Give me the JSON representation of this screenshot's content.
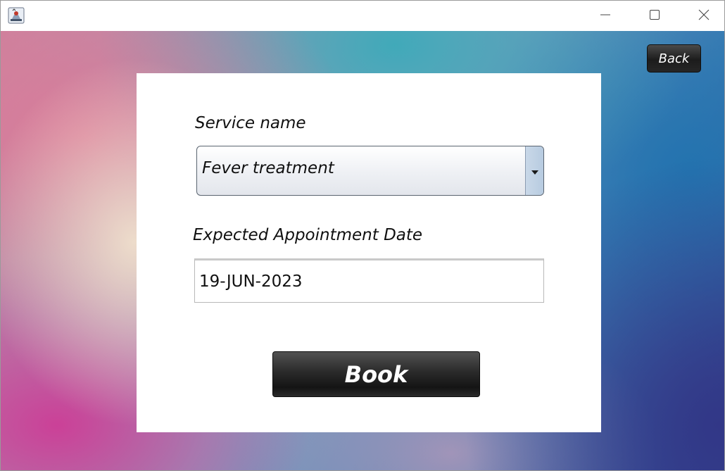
{
  "window": {
    "controls": {
      "minimize_icon": "minimize-icon",
      "maximize_icon": "maximize-icon",
      "close_icon": "close-icon"
    }
  },
  "header": {
    "back_label": "Back"
  },
  "form": {
    "service_label": "Service name",
    "service_selected": "Fever treatment",
    "date_label": "Expected Appointment Date",
    "date_value": "19-JUN-2023",
    "book_label": "Book"
  },
  "colors": {
    "button_dark": "#1c1c1c",
    "panel_bg": "#ffffff",
    "combo_arrow_bg": "#b7cbe0"
  }
}
